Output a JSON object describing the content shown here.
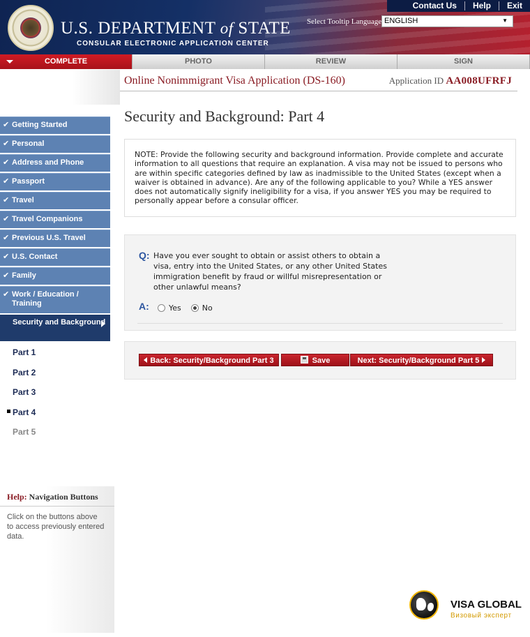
{
  "header": {
    "links": [
      "Contact Us",
      "Help",
      "Exit"
    ],
    "dept_part1": "U.S. DEPARTMENT ",
    "dept_of": "of",
    "dept_part2": " STATE",
    "dept_sub": "CONSULAR ELECTRONIC APPLICATION CENTER",
    "tooltip_label": "Select Tooltip Language",
    "language": "ENGLISH"
  },
  "tabs": [
    {
      "label": "COMPLETE",
      "active": true
    },
    {
      "label": "PHOTO",
      "active": false
    },
    {
      "label": "REVIEW",
      "active": false
    },
    {
      "label": "SIGN",
      "active": false
    }
  ],
  "app": {
    "title": "Online Nonimmigrant Visa Application (DS-160)",
    "id_label": "Application ID",
    "id_value": "AA008UFRFJ"
  },
  "sidebar": {
    "items": [
      "Getting Started",
      "Personal",
      "Address and Phone",
      "Passport",
      "Travel",
      "Travel Companions",
      "Previous U.S. Travel",
      "U.S. Contact",
      "Family",
      "Work / Education / Training"
    ],
    "current": "Security and Background",
    "parts": [
      "Part 1",
      "Part 2",
      "Part 3",
      "Part 4",
      "Part 5"
    ]
  },
  "help": {
    "label": "Help:",
    "topic": " Navigation Buttons",
    "text": "Click on the buttons above to access previously entered data."
  },
  "main": {
    "page_title": "Security and Background: Part 4",
    "note": "NOTE: Provide the following security and background information. Provide complete and accurate information to all questions that require an explanation. A visa may not be issued to persons who are within specific categories defined by law as inadmissible to the United States (except when a waiver is obtained in advance). Are any of the following applicable to you? While a YES answer does not automatically signify ineligibility for a visa, if you answer YES you may be required to personally appear before a consular officer.",
    "q_label": "Q:",
    "question": "Have you ever sought to obtain or assist others to obtain a visa, entry into the United States, or any other United States immigration benefit by fraud or willful misrepresentation or other unlawful means?",
    "a_label": "A:",
    "yes_label": "Yes",
    "no_label": "No",
    "selected": "No"
  },
  "buttons": {
    "back": "Back: Security/Background Part 3",
    "save": "Save",
    "next": "Next: Security/Background Part 5"
  },
  "watermark": {
    "title": "VISA GLOBAL",
    "subtitle": "Визовый эксперт"
  }
}
